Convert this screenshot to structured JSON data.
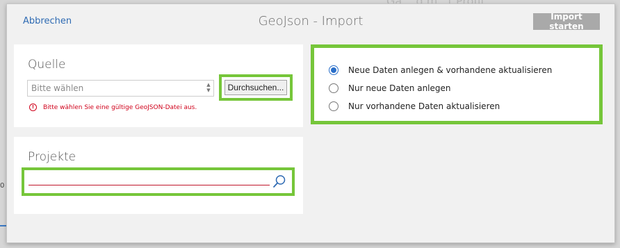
{
  "background": {
    "partial_text": "Ga....d.m...t Profil",
    "edge_digit": "0"
  },
  "header": {
    "cancel_label": "Abbrechen",
    "title": "GeoJson - Import",
    "start_label": "Import starten"
  },
  "source": {
    "heading": "Quelle",
    "select_value": "Bitte wählen",
    "browse_label": "Durchsuchen...",
    "error_text": "Bitte wählen Sie eine gültige GeoJSON-Datei aus."
  },
  "projects": {
    "heading": "Projekte"
  },
  "options": {
    "items": [
      {
        "label": "Neue Daten anlegen & vorhandene aktualisieren",
        "checked": true
      },
      {
        "label": "Nur neue Daten anlegen",
        "checked": false
      },
      {
        "label": "Nur vorhandene Daten aktualisieren",
        "checked": false
      }
    ]
  },
  "colors": {
    "accent_blue": "#2f6bb3",
    "highlight_green": "#76c63a",
    "error_red": "#d0021b",
    "disabled_gray": "#a9a9a9"
  }
}
